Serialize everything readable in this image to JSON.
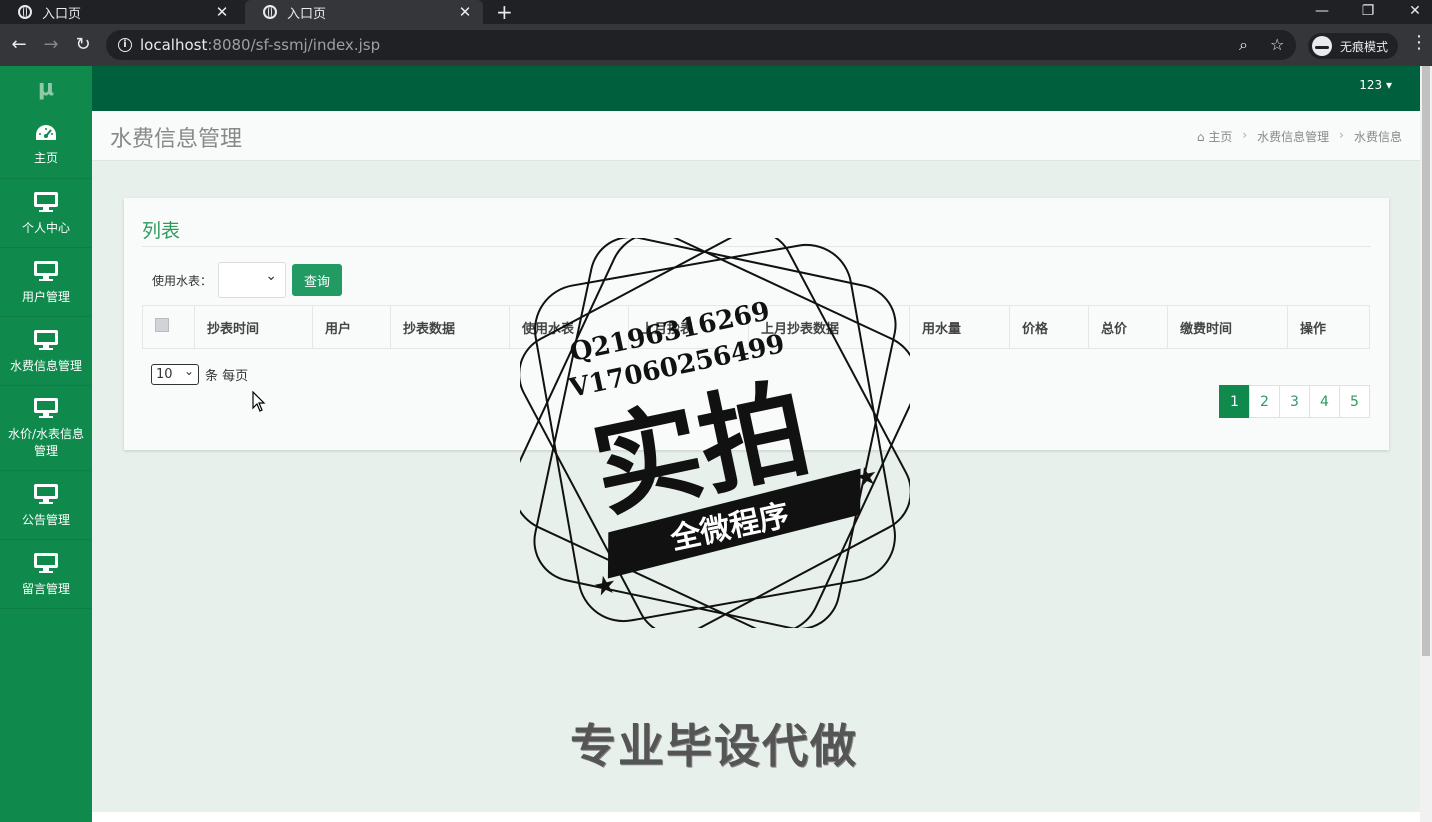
{
  "browser": {
    "tabs": [
      {
        "title": "入口页",
        "active": false
      },
      {
        "title": "入口页",
        "active": true
      }
    ],
    "url_host": "localhost",
    "url_path": ":8080/sf-ssmj/index.jsp",
    "incognito_label": "无痕模式"
  },
  "sidebar": {
    "logo": "μ",
    "items": [
      {
        "label": "主页",
        "icon": "dashboard-icon"
      },
      {
        "label": "个人中心",
        "icon": "monitor-icon"
      },
      {
        "label": "用户管理",
        "icon": "monitor-icon"
      },
      {
        "label": "水费信息管理",
        "icon": "monitor-icon"
      },
      {
        "label": "水价/水表信息管理",
        "icon": "monitor-icon"
      },
      {
        "label": "公告管理",
        "icon": "monitor-icon"
      },
      {
        "label": "留言管理",
        "icon": "monitor-icon"
      }
    ]
  },
  "topbar": {
    "user": "123"
  },
  "page": {
    "title": "水费信息管理",
    "breadcrumb": [
      "主页",
      "水费信息管理",
      "水费信息"
    ]
  },
  "card": {
    "title": "列表",
    "filter_label": "使用水表：",
    "query_button": "查询",
    "columns": [
      "抄表时间",
      "用户",
      "抄表数据",
      "使用水表",
      "上月抄表",
      "上月抄表数据",
      "用水量",
      "价格",
      "总价",
      "缴费时间",
      "操作"
    ],
    "page_size_value": "10",
    "page_size_suffix": "条 每页",
    "pages": [
      "1",
      "2",
      "3",
      "4",
      "5"
    ],
    "active_page": "1"
  },
  "watermark": {
    "line1": "Q2196316269",
    "line2": "V17060256499",
    "big": "实拍",
    "ribbon": "全微程序",
    "bottom": "专业毕设代做"
  },
  "colors": {
    "sidebar": "#0f8a4c",
    "topbar": "#005f3c",
    "accent": "#2e9a5e"
  }
}
